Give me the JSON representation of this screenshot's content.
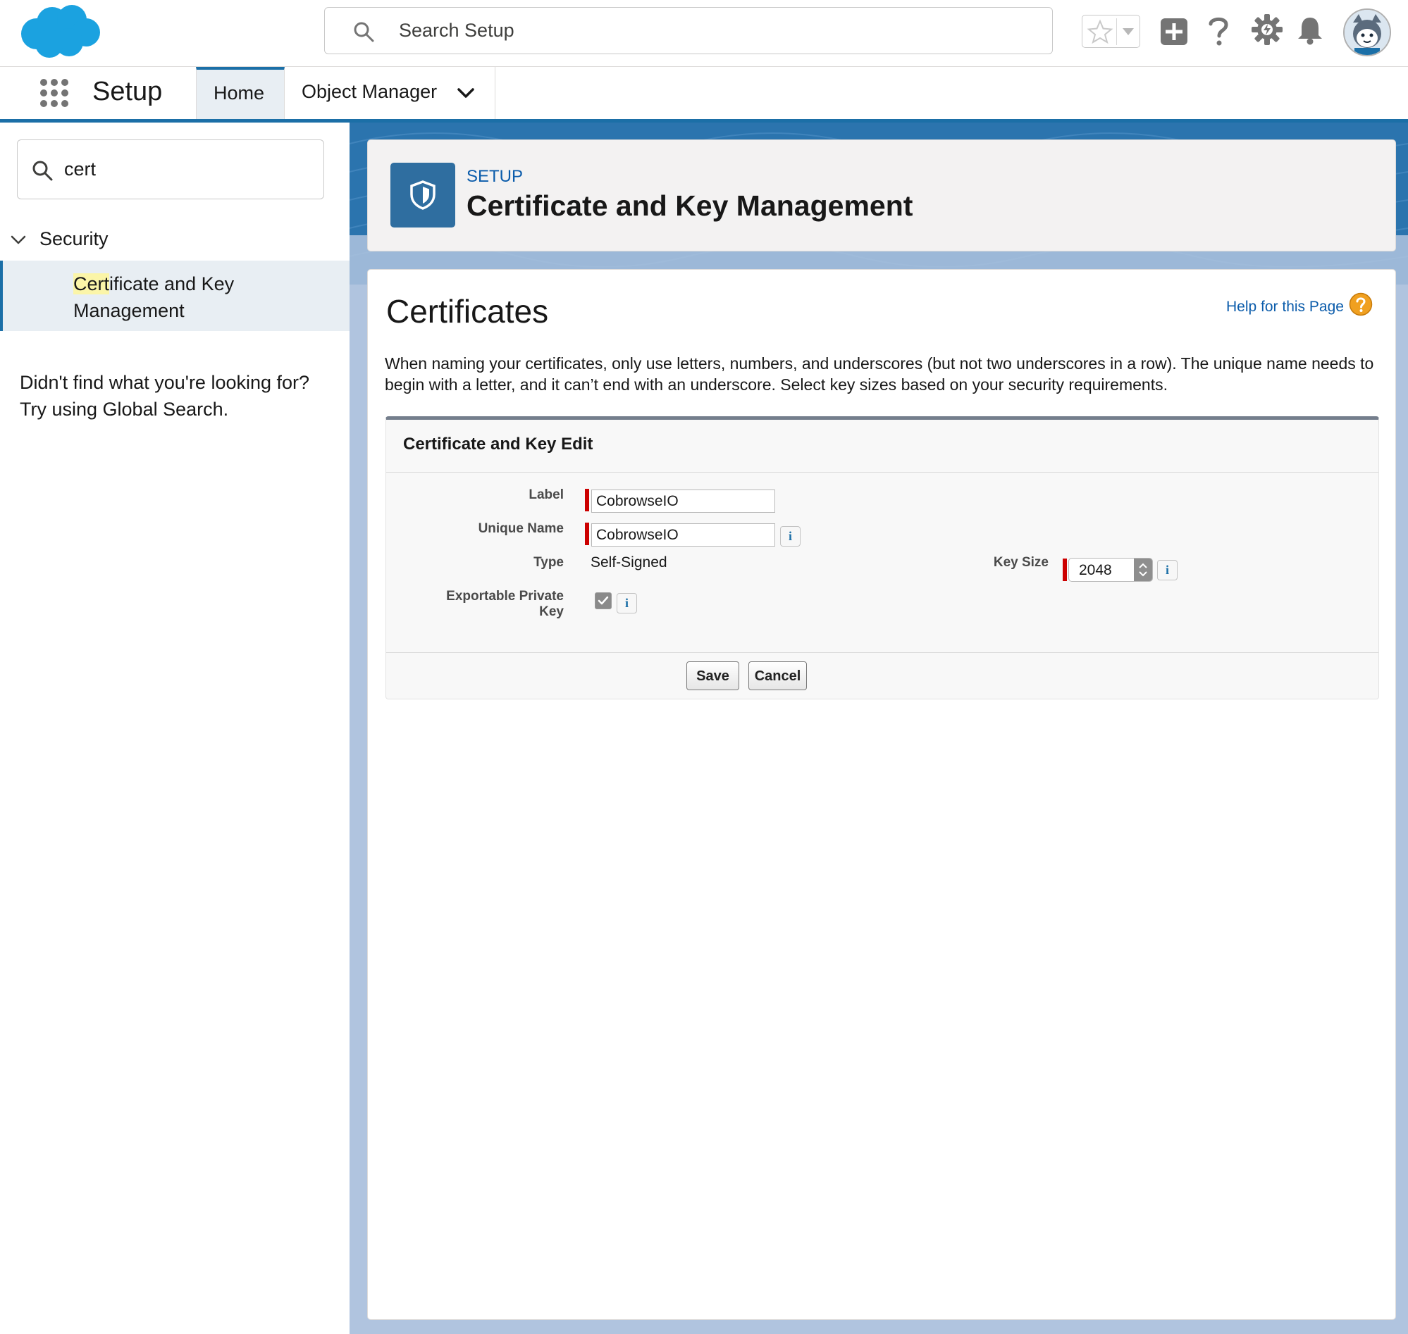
{
  "header": {
    "search_placeholder": "Search Setup"
  },
  "nav": {
    "app_name": "Setup",
    "tabs": [
      {
        "label": "Home"
      },
      {
        "label": "Object Manager"
      }
    ]
  },
  "sidebar": {
    "quick_find_value": "cert",
    "section_label": "Security",
    "item_match": "Cert",
    "item_rest": "ificate and Key Management",
    "not_found_line1": "Didn't find what you're looking for?",
    "not_found_line2": "Try using Global Search."
  },
  "page_header": {
    "eyebrow": "SETUP",
    "title": "Certificate and Key Management"
  },
  "main": {
    "title": "Certificates",
    "help_link": "Help for this Page",
    "intro": "When naming your certificates, only use letters, numbers, and underscores (but not two underscores in a row). The unique name needs to begin with a letter, and it can’t end with an underscore. Select key sizes based on your security requirements.",
    "form": {
      "title": "Certificate and Key Edit",
      "label_label": "Label",
      "label_value": "CobrowseIO",
      "unique_name_label": "Unique Name",
      "unique_name_value": "CobrowseIO",
      "type_label": "Type",
      "type_value": "Self-Signed",
      "exportable_label_line1": "Exportable Private",
      "exportable_label_line2": "Key",
      "exportable_checked": true,
      "key_size_label": "Key Size",
      "key_size_value": "2048",
      "info_glyph": "i",
      "save_label": "Save",
      "cancel_label": "Cancel"
    }
  },
  "colors": {
    "brand_blue": "#1b6fa7",
    "link_blue": "#0b5cab",
    "required_red": "#cc0000",
    "cloud_blue": "#1798c1"
  }
}
